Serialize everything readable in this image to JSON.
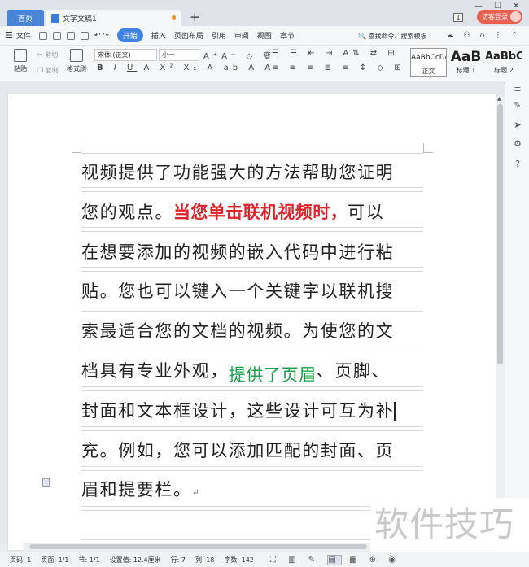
{
  "tabs": {
    "home": "首页",
    "document": "文字文稿1",
    "new_tab": "+"
  },
  "titlebar": {
    "badge": "1",
    "login": "访客登录"
  },
  "menu": {
    "file": "文件",
    "tabs": [
      "开始",
      "插入",
      "页面布局",
      "引用",
      "审阅",
      "视图",
      "章节"
    ],
    "search": "查找命令、搜索模板"
  },
  "ribbon": {
    "paste": "粘贴",
    "cut": "剪切",
    "copy": "复制",
    "format_painter": "格式刷",
    "font_name": "宋体 (正文)",
    "font_size": "小一",
    "styles": [
      {
        "preview": "AaBbCcDd",
        "name": "正文"
      },
      {
        "preview": "AaB",
        "name": "标题 1"
      },
      {
        "preview": "AaBbC",
        "name": "标题 2"
      }
    ]
  },
  "document": {
    "lines": [
      {
        "parts": [
          {
            "text": "视频提供了功能强大的方法帮助您证明",
            "style": "normal"
          }
        ]
      },
      {
        "parts": [
          {
            "text": "您的观点。",
            "style": "normal"
          },
          {
            "text": "当您单击联机视频时，",
            "style": "red"
          },
          {
            "text": "可以",
            "style": "normal"
          }
        ]
      },
      {
        "parts": [
          {
            "text": "在想要添加的视频的嵌入代码中进行粘",
            "style": "normal"
          }
        ]
      },
      {
        "parts": [
          {
            "text": "贴。您也可以键入一个关键字以联机搜",
            "style": "normal"
          }
        ]
      },
      {
        "parts": [
          {
            "text": "索最适合您的文档的视频。为使您的文",
            "style": "normal"
          }
        ]
      },
      {
        "parts": [
          {
            "text": "档具有专业外观，",
            "style": "normal"
          },
          {
            "text": "提供了页眉",
            "style": "green"
          },
          {
            "text": "、页脚、",
            "style": "normal"
          }
        ]
      },
      {
        "parts": [
          {
            "text": "封面和文本框设计，这些设计可互为补",
            "style": "normal"
          }
        ],
        "cursor": true
      },
      {
        "parts": [
          {
            "text": "充。例如，您可以添加匹配的封面、页",
            "style": "normal"
          }
        ]
      },
      {
        "parts": [
          {
            "text": "眉和提要栏。",
            "style": "normal"
          }
        ],
        "para_mark": "↵"
      }
    ]
  },
  "status": {
    "page_num": "页码: 1",
    "pages": "页面: 1/1",
    "section": "节: 1/1",
    "position": "设置值: 12.4厘米",
    "row": "行: 7",
    "col": "列: 18",
    "words": "字数: 142"
  },
  "watermark": "软件技巧",
  "colors": {
    "accent": "#3f82e5",
    "red_text": "#e0222a",
    "green_text": "#1aa24a",
    "login": "#e8614f"
  }
}
